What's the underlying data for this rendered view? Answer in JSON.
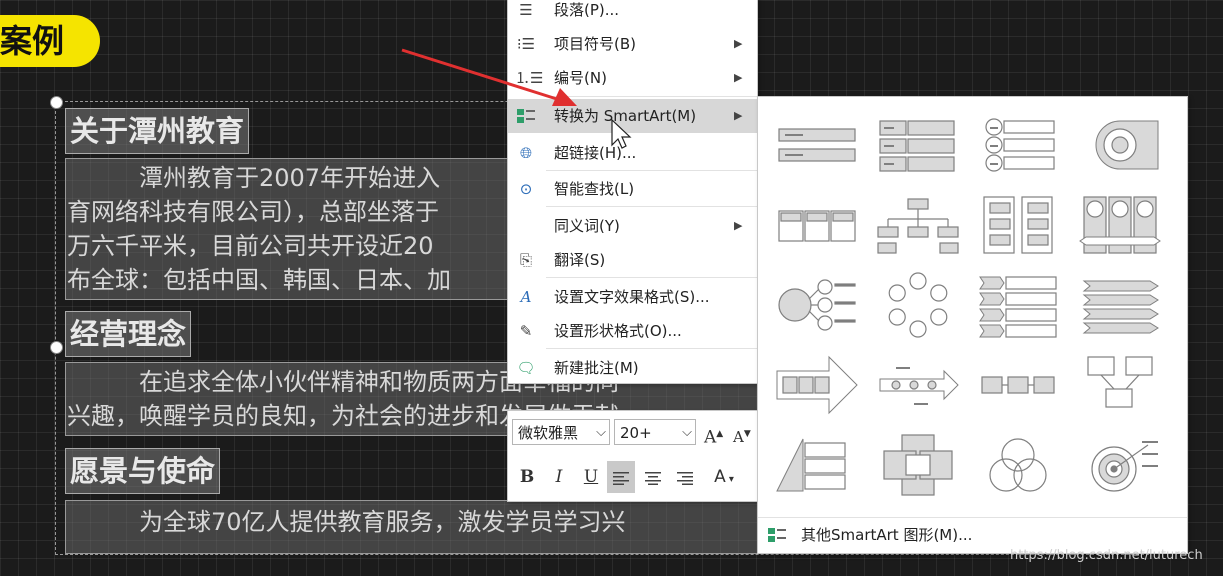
{
  "slide": {
    "badge_text": "案例",
    "headings": [
      "关于潭州教育",
      "经营理念",
      "愿景与使命"
    ],
    "para1": [
      "　　　潭州教育于2007年开始进入",
      "育网络科技有限公司），总部坐落于",
      "万六千平米，目前公司共开设近20",
      "布全球：包括中国、韩国、日本、加"
    ],
    "para2": [
      "　　　在追求全体小伙伴精神和物质两方面幸福的同",
      "兴趣，唤醒学员的良知，为社会的进步和发展做贡献"
    ],
    "para3": [
      "　　　为全球70亿人提供教育服务，激发学员学习兴"
    ]
  },
  "context_menu": {
    "items": [
      {
        "label": "段落(P)...",
        "icon": "paragraph-icon",
        "submenu": false
      },
      {
        "label": "项目符号(B)",
        "icon": "bullets-icon",
        "submenu": true
      },
      {
        "label": "编号(N)",
        "icon": "numbering-icon",
        "submenu": true
      },
      {
        "label": "转换为 SmartArt(M)",
        "icon": "smartart-icon",
        "submenu": true,
        "active": true
      },
      {
        "label": "超链接(H)...",
        "icon": "hyperlink-icon",
        "submenu": false
      },
      {
        "label": "智能查找(L)",
        "icon": "smart-lookup-icon",
        "submenu": false
      },
      {
        "label": "同义词(Y)",
        "icon": "",
        "submenu": true
      },
      {
        "label": "翻译(S)",
        "icon": "translate-icon",
        "submenu": false
      },
      {
        "label": "设置文字效果格式(S)...",
        "icon": "text-effect-icon",
        "submenu": false
      },
      {
        "label": "设置形状格式(O)...",
        "icon": "shape-format-icon",
        "submenu": false
      },
      {
        "label": "新建批注(M)",
        "icon": "comment-icon",
        "submenu": false
      }
    ],
    "submenu_arrow": "▶"
  },
  "mini_toolbar": {
    "font_name": "微软雅黑",
    "font_size": "20+",
    "dropdown_glyph": "⌵",
    "grow_font": "A",
    "shrink_font": "A",
    "bold": "B",
    "italic": "I",
    "underline": "U",
    "font_color": "A"
  },
  "gallery": {
    "more_label": "其他SmartArt 图形(M)...",
    "line_color": "#7f7f7f",
    "fill_color": "#d9d9d9"
  },
  "watermark": "https://blog.csdn.net/luturech"
}
